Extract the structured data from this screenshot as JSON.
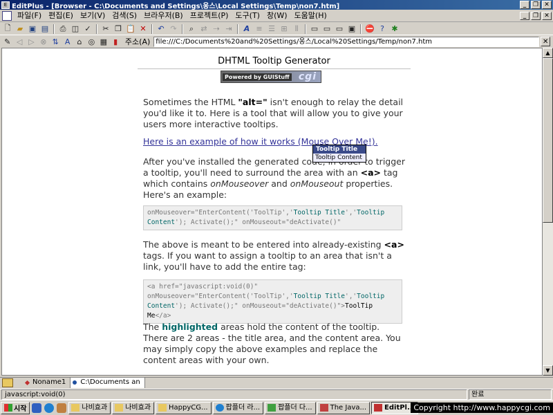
{
  "window": {
    "title": "EditPlus - [Browser - C:\\Documents and Settings\\옹스\\Local Settings\\Temp\\non7.htm]",
    "app_icon": "E",
    "minimize": "_",
    "restore": "❐",
    "close": "✕"
  },
  "menu": [
    "파일(F)",
    "편집(E)",
    "보기(V)",
    "검색(S)",
    "브라우저(B)",
    "프로젝트(P)",
    "도구(T)",
    "창(W)",
    "도움말(H)"
  ],
  "toolbar_icons": [
    "new-file-icon",
    "open-folder-icon",
    "save-icon",
    "save-all-icon",
    "print-icon",
    "print-preview-icon",
    "spellcheck-icon",
    "cut-icon",
    "copy-icon",
    "paste-icon",
    "delete-icon",
    "undo-icon",
    "redo-icon",
    "find-icon",
    "replace-icon",
    "bold-icon",
    "word-wrap-icon",
    "line-number-icon",
    "ruler-icon",
    "column-icon",
    "window-tile-icon",
    "stop-icon",
    "help-icon",
    "browser-icon"
  ],
  "address": {
    "label": "주소(A)",
    "value": "file:///C:/Documents%20and%20Settings/옹스/Local%20Settings/Temp/non7.htm",
    "close": "✕"
  },
  "page": {
    "title": "DHTML Tooltip Generator",
    "powered_text": "Powered by GUIStuff",
    "powered_logo": "cgi",
    "p1_a": "Sometimes the HTML ",
    "p1_alt": "\"alt=\"",
    "p1_b": " isn't enough to relay the detail you'd like it to. Here is a tool that will allow you to give your users more interactive tooltips.",
    "example_link": "Here is an example of how it works (Mouse Over Me!).",
    "p2_a": "After you've installed the generated code, in order to trigger a tooltip, you'll need to surround the area with an ",
    "p2_tag": "<a>",
    "p2_b": " tag which contains ",
    "p2_over": "onMouseover",
    "p2_c": " and ",
    "p2_out": "onMouseout",
    "p2_d": " properties. Here's an example:",
    "code1_a": "onMouseover=\"EnterContent('ToolTip','",
    "code1_title": "Tooltip Title",
    "code1_b": "','",
    "code1_content": "Tooltip Content",
    "code1_c": "'); Activate();\" onMouseout=\"deActivate()\"",
    "p3_a": "The above is meant to be entered into already-existing ",
    "p3_tag": "<a>",
    "p3_b": " tags. If you want to assign a tooltip to an area that isn't a link, you'll have to add the entire tag:",
    "code2_a": "<a href=\"javascript:void(0)\" onMouseover=\"EnterContent('ToolTip','",
    "code2_title": "Tooltip Title",
    "code2_b": "','",
    "code2_content": "Tooltip Content",
    "code2_c": "'); Activate();\" onMouseout=\"deActivate()\">",
    "code2_me": "ToolTip Me",
    "code2_end": "</a>",
    "p4_a": "The ",
    "p4_hl": "highlighted",
    "p4_b": " areas hold the content of the tooltip. There are 2 areas - the title area, and the content area. You may simply copy the above examples and replace the content areas with your own."
  },
  "tooltip": {
    "title": "Tooltip Title",
    "content": "Tooltip Content"
  },
  "doc_tabs": [
    "Noname1",
    "C:\\Documents an"
  ],
  "status": {
    "text": "javascript:void(0)",
    "right": "완료"
  },
  "taskbar": {
    "start": "시작",
    "buttons": [
      "나비효과",
      "나비효과",
      "HappyCG...",
      "팝플더 라...",
      "팝플더 다...",
      "The Java...",
      "EditPl..."
    ],
    "copyright": "Copyright   http://www.happycgi.com"
  },
  "colors": {
    "title_bar": "#0a246a",
    "link": "#333399",
    "highlight": "#006666",
    "tooltip_title_bg": "#3a4a8a"
  }
}
